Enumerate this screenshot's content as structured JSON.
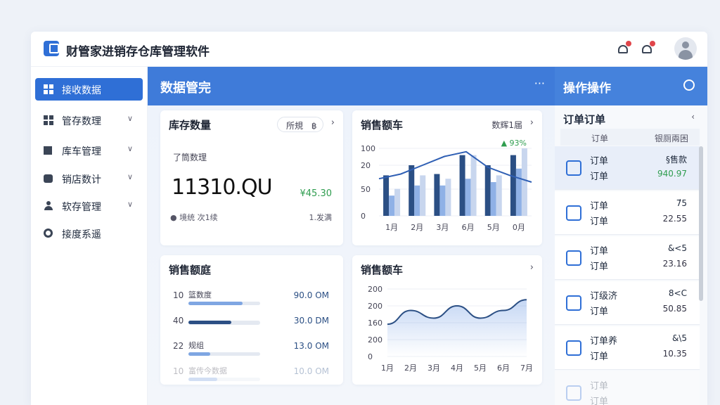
{
  "app": {
    "title": "财管家进销存仓库管理软件"
  },
  "sidebar": {
    "items": [
      {
        "label": "接收数据",
        "active": true
      },
      {
        "label": "管存数理",
        "chevron": true
      },
      {
        "label": "库车管理",
        "chevron": true
      },
      {
        "label": "销店数计",
        "chevron": true
      },
      {
        "label": "软存管理",
        "chevron": true
      },
      {
        "label": "接度系遥"
      }
    ]
  },
  "main": {
    "title": "数据管完",
    "more": "···",
    "inventory": {
      "title": "库存数量",
      "filter": "所規",
      "filter_icon": "฿",
      "sub": "了筒数理",
      "value": "11310.QU",
      "change": "¥45.30",
      "foot_left": "● 境统  次1续",
      "foot_right": "1.发满"
    },
    "sales_freq": {
      "title": "销售额车",
      "meta": "数辉1届",
      "badge": "▲ 93%"
    },
    "sales_amount": {
      "title": "销售额庭",
      "rows": [
        {
          "num": "10",
          "label": "篮数度",
          "value": "90.0 OM",
          "fill": 0.75
        },
        {
          "num": "40",
          "label": "",
          "value": "30.0 DM",
          "fill": 0.6
        },
        {
          "num": "22",
          "label": "规组",
          "value": "13.0 OM",
          "fill": 0.3
        },
        {
          "num": "10",
          "label": "富传今数据",
          "value": "10.0 OM",
          "fill": 0.4
        }
      ]
    },
    "sales_trend": {
      "title": "销售额车"
    }
  },
  "right": {
    "title": "操作操作",
    "orders_title": "订单订单",
    "orders_close": "‹",
    "col_a": "订单",
    "col_b": "银厕兩困",
    "orders": [
      {
        "l1": "订单",
        "l2": "订单",
        "r1": "§售款",
        "r2": "940.97",
        "green": true,
        "selected": true
      },
      {
        "l1": "订单",
        "l2": "订单",
        "r1": "7́5",
        "r2": "22.55"
      },
      {
        "l1": "订单",
        "l2": "订单",
        "r1": "&<5",
        "r2": "23.16"
      },
      {
        "l1": "订级济",
        "l2": "订单",
        "r1": "8<C",
        "r2": "50.85"
      },
      {
        "l1": "订单养",
        "l2": "订单",
        "r1": "&\\5",
        "r2": "10.35"
      },
      {
        "l1": "订单",
        "l2": "订单",
        "r1": "",
        "r2": ""
      }
    ]
  },
  "chart_data": [
    {
      "type": "bar",
      "title": "销售额车",
      "categories": [
        "1月",
        "2月",
        "3月",
        "6月",
        "5月",
        "0月"
      ],
      "ylim": [
        0,
        100
      ],
      "yticks": [
        "100",
        "20",
        "50",
        "0"
      ],
      "series": [
        {
          "values": [
            60,
            75,
            62,
            90,
            75,
            90
          ],
          "color": "#2b4f84"
        },
        {
          "values": [
            30,
            45,
            45,
            55,
            50,
            70
          ],
          "color": "#8fb1e6"
        },
        {
          "values": [
            40,
            60,
            55,
            90,
            60,
            100
          ],
          "color": "#c8d6ee"
        }
      ],
      "line": [
        55,
        62,
        75,
        88,
        95,
        72,
        60,
        50
      ],
      "grid": true
    },
    {
      "type": "area",
      "title": "销售额车",
      "x": [
        "1月",
        "2月",
        "3月",
        "4月",
        "5月",
        "6月",
        "7月"
      ],
      "yticks": [
        "200",
        "200",
        "160",
        "200",
        "0"
      ],
      "ylim": [
        0,
        220
      ],
      "values": [
        105,
        150,
        125,
        165,
        125,
        150,
        185
      ],
      "grid": true
    }
  ]
}
